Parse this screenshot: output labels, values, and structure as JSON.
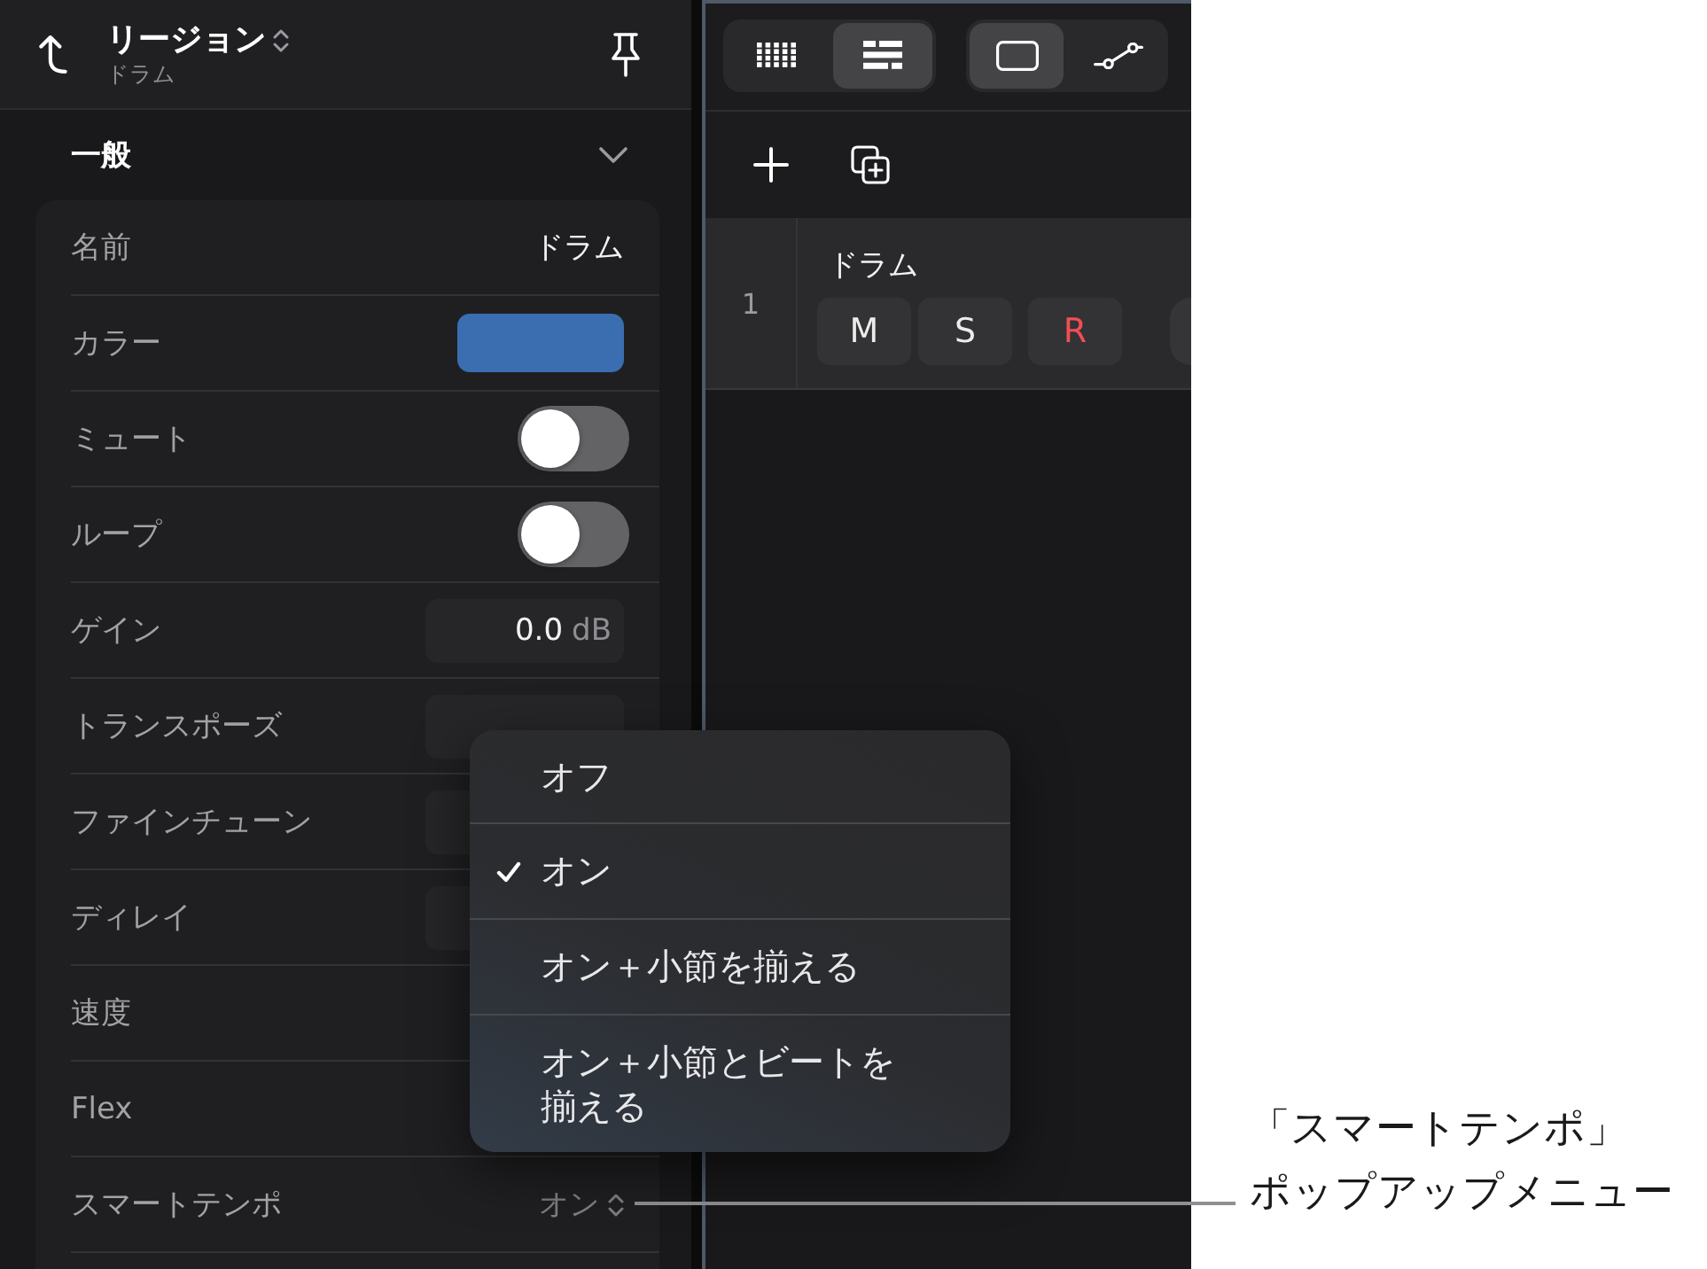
{
  "inspector": {
    "header": {
      "title": "リージョン",
      "subtitle": "ドラム"
    },
    "section": {
      "title": "一般",
      "expanded": true
    },
    "rows": [
      {
        "kind": "text",
        "label": "名前",
        "value": "ドラム"
      },
      {
        "kind": "color",
        "label": "カラー",
        "color": "#3a6eb0"
      },
      {
        "kind": "toggle",
        "label": "ミュート",
        "on": false
      },
      {
        "kind": "toggle",
        "label": "ループ",
        "on": false
      },
      {
        "kind": "field",
        "label": "ゲイン",
        "value": "0.0",
        "unit": "dB"
      },
      {
        "kind": "field",
        "label": "トランスポーズ"
      },
      {
        "kind": "field",
        "label": "ファインチューン"
      },
      {
        "kind": "field",
        "label": "ディレイ"
      },
      {
        "kind": "blank",
        "label": "速度"
      },
      {
        "kind": "blank",
        "label": "Flex"
      },
      {
        "kind": "popup",
        "label": "スマートテンポ",
        "value": "オン"
      }
    ]
  },
  "track_area": {
    "view_buttons": [
      {
        "kind": "grid",
        "selected": false
      },
      {
        "kind": "list",
        "selected": true
      }
    ],
    "mode_buttons": [
      {
        "kind": "region",
        "selected": true
      },
      {
        "kind": "automation",
        "selected": false
      }
    ],
    "track": {
      "number": "1",
      "name": "ドラム",
      "buttons": [
        {
          "kind": "mute",
          "label": "M"
        },
        {
          "kind": "solo",
          "label": "S"
        },
        {
          "kind": "record",
          "label": "R"
        }
      ]
    }
  },
  "popup_menu": {
    "items": [
      {
        "label": "オフ",
        "selected": false
      },
      {
        "label": "オン",
        "selected": true
      },
      {
        "label": "オン＋小節を揃える",
        "selected": false
      },
      {
        "label": "オン＋小節とビートを揃える",
        "selected": false
      }
    ]
  },
  "callout": {
    "lines": [
      "「スマートテンポ」",
      "ポップアップメニュー"
    ]
  }
}
